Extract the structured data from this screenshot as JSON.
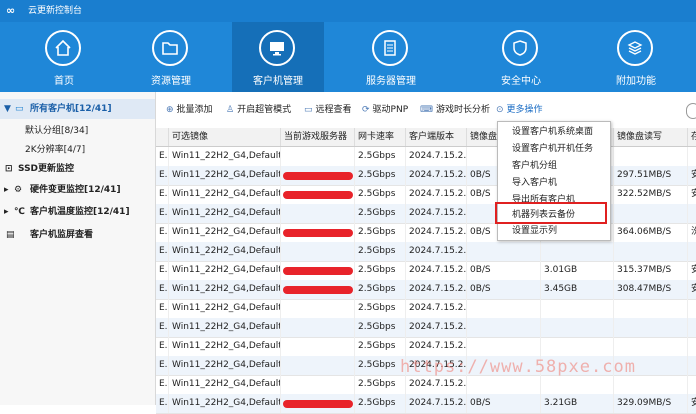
{
  "window": {
    "logo": "∞",
    "title": "云更新控制台"
  },
  "nav": [
    {
      "label": "首页",
      "icon": "home-icon"
    },
    {
      "label": "资源管理",
      "icon": "folder-icon"
    },
    {
      "label": "客户机管理",
      "icon": "monitor-icon",
      "active": true
    },
    {
      "label": "服务器管理",
      "icon": "server-icon"
    },
    {
      "label": "安全中心",
      "icon": "shield-icon"
    },
    {
      "label": "附加功能",
      "icon": "plugin-icon"
    }
  ],
  "sidebar": {
    "items": [
      {
        "label": "所有客户机[12/41]"
      },
      {
        "label": "默认分组[8/34]"
      },
      {
        "label": "2K分辨率[4/7]"
      },
      {
        "label": "SSD更新监控"
      },
      {
        "label": "硬件变更监控[12/41]"
      },
      {
        "label": "客户机温度监控[12/41]"
      },
      {
        "label": "客户机监屏查看"
      }
    ]
  },
  "toolbar": {
    "batch_add": "批量添加",
    "super_mode": "开启超管模式",
    "remote": "远程查看",
    "driver": "驱动PNP",
    "game_time": "游戏时长分析",
    "more": "更多操作"
  },
  "table": {
    "headers": [
      "可选镜像",
      "当前游戏服务器",
      "网卡速率",
      "客户端版本",
      "镜像盘",
      "",
      "镜像盘读写",
      "存"
    ],
    "rows": [
      [
        "Win11_22H2_G4,Default;",
        "",
        "2.5Gbps",
        "2024.7.15.2...",
        "",
        "",
        "",
        ""
      ],
      [
        "Win11_22H2_G4,Default;",
        "",
        "2.5Gbps",
        "2024.7.15.2...",
        "0B/S",
        "",
        "297.51MB/S",
        "安"
      ],
      [
        "Win11_22H2_G4,Default;",
        "",
        "2.5Gbps",
        "2024.7.15.2...",
        "0B/S",
        "",
        "322.52MB/S",
        "安"
      ],
      [
        "Win11_22H2_G4,Default;",
        "",
        "2.5Gbps",
        "2024.7.15.2...",
        "",
        "",
        "",
        ""
      ],
      [
        "Win11_22H2_G4,Default;",
        "",
        "2.5Gbps",
        "2024.7.15.2...",
        "0B/S",
        "",
        "364.06MB/S",
        "汾"
      ],
      [
        "Win11_22H2_G4,Default;",
        "",
        "2.5Gbps",
        "2024.7.15.2...",
        "",
        "",
        "",
        ""
      ],
      [
        "Win11_22H2_G4,Default;",
        "",
        "2.5Gbps",
        "2024.7.15.2...",
        "0B/S",
        "3.01GB",
        "315.37MB/S",
        "安"
      ],
      [
        "Win11_22H2_G4,Default;",
        "",
        "2.5Gbps",
        "2024.7.15.2...",
        "0B/S",
        "3.45GB",
        "308.47MB/S",
        "安"
      ],
      [
        "Win11_22H2_G4,Default;",
        "",
        "2.5Gbps",
        "2024.7.15.2...",
        "",
        "",
        "",
        ""
      ],
      [
        "Win11_22H2_G4,Default;",
        "",
        "2.5Gbps",
        "2024.7.15.2...",
        "",
        "",
        "",
        ""
      ],
      [
        "Win11_22H2_G4,Default;",
        "",
        "2.5Gbps",
        "2024.7.15.2...",
        "",
        "",
        "",
        ""
      ],
      [
        "Win11_22H2_G4,Default;",
        "",
        "2.5Gbps",
        "2024.7.15.2...",
        "",
        "",
        "",
        ""
      ],
      [
        "Win11_22H2_G4,Default;",
        "",
        "2.5Gbps",
        "2024.7.15.2...",
        "",
        "",
        "",
        ""
      ],
      [
        "Win11_22H2_G4,Default;",
        "",
        "2.5Gbps",
        "2024.7.15.2...",
        "0B/S",
        "3.21GB",
        "329.09MB/S",
        "安"
      ]
    ]
  },
  "context_menu": {
    "items": [
      "设置客户机系统桌面",
      "设置客户机开机任务",
      "客户机分组",
      "导入客户机",
      "导出所有客户机",
      "机器列表云备份",
      "设置显示列"
    ],
    "highlighted_index": 5
  },
  "watermark": "https://www.58pxe.com",
  "colors": {
    "nav": "#1f87d8",
    "nav_active": "#156fb8",
    "highlight": "#e02020",
    "redaction": "#e8232a"
  }
}
